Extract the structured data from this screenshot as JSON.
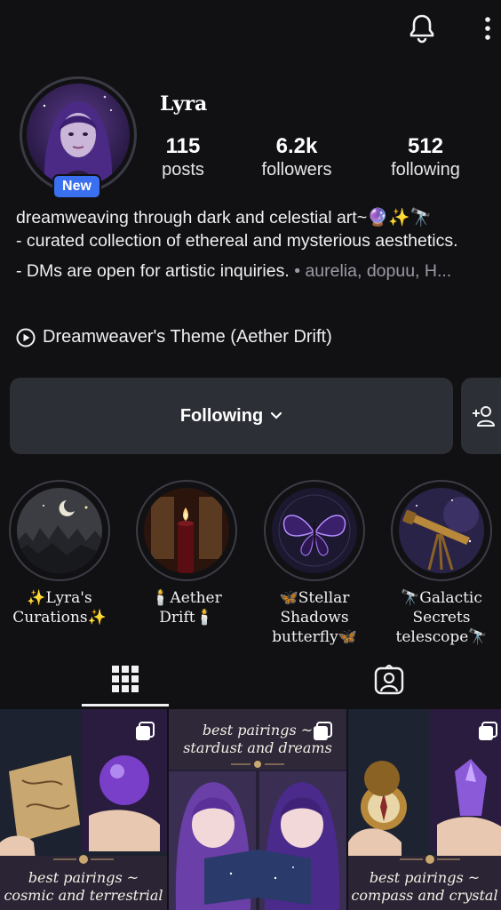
{
  "profile": {
    "username": "Lyra",
    "new_badge": "New",
    "stats": {
      "posts_count": "115",
      "posts_label": "posts",
      "followers_count": "6.2k",
      "followers_label": "followers",
      "following_count": "512",
      "following_label": "following"
    },
    "bio": {
      "line1": "dreamweaving through dark and celestial art~🔮✨🔭",
      "line2": "- curated collection of ethereal and mysterious aesthetics.",
      "line3": "- DMs are open for artistic inquiries.",
      "mutuals": "• aurelia, dopuu, H..."
    },
    "music": "Dreamweaver's Theme (Aether Drift)"
  },
  "actions": {
    "following_label": "Following",
    "icons": {
      "add_user": "add-user-icon",
      "bell": "bell-icon",
      "more": "more-icon"
    }
  },
  "highlights": [
    {
      "line1": "✨Lyra's",
      "line2": "Curations✨",
      "line3": ""
    },
    {
      "line1": "🕯️Aether",
      "line2": "Drift🕯️",
      "line3": ""
    },
    {
      "line1": "🦋Stellar",
      "line2": "Shadows",
      "line3": "butterfly🦋"
    },
    {
      "line1": "🔭Galactic",
      "line2": "Secrets",
      "line3": "telescope🔭"
    }
  ],
  "tabs": {
    "grid": "grid-icon",
    "tagged": "tagged-icon",
    "active": "grid"
  },
  "posts": [
    {
      "caption_line1": "best pairings ~",
      "caption_line2": "cosmic and terrestrial"
    },
    {
      "caption_line1": "best pairings ~",
      "caption_line2": "stardust and dreams"
    },
    {
      "caption_line1": "best pairings ~",
      "caption_line2": "compass and crystal"
    }
  ],
  "colors": {
    "background": "#111114",
    "button": "#2c2f35",
    "badge": "#3a6ff0",
    "accent_purple": "#7b4fc9"
  }
}
